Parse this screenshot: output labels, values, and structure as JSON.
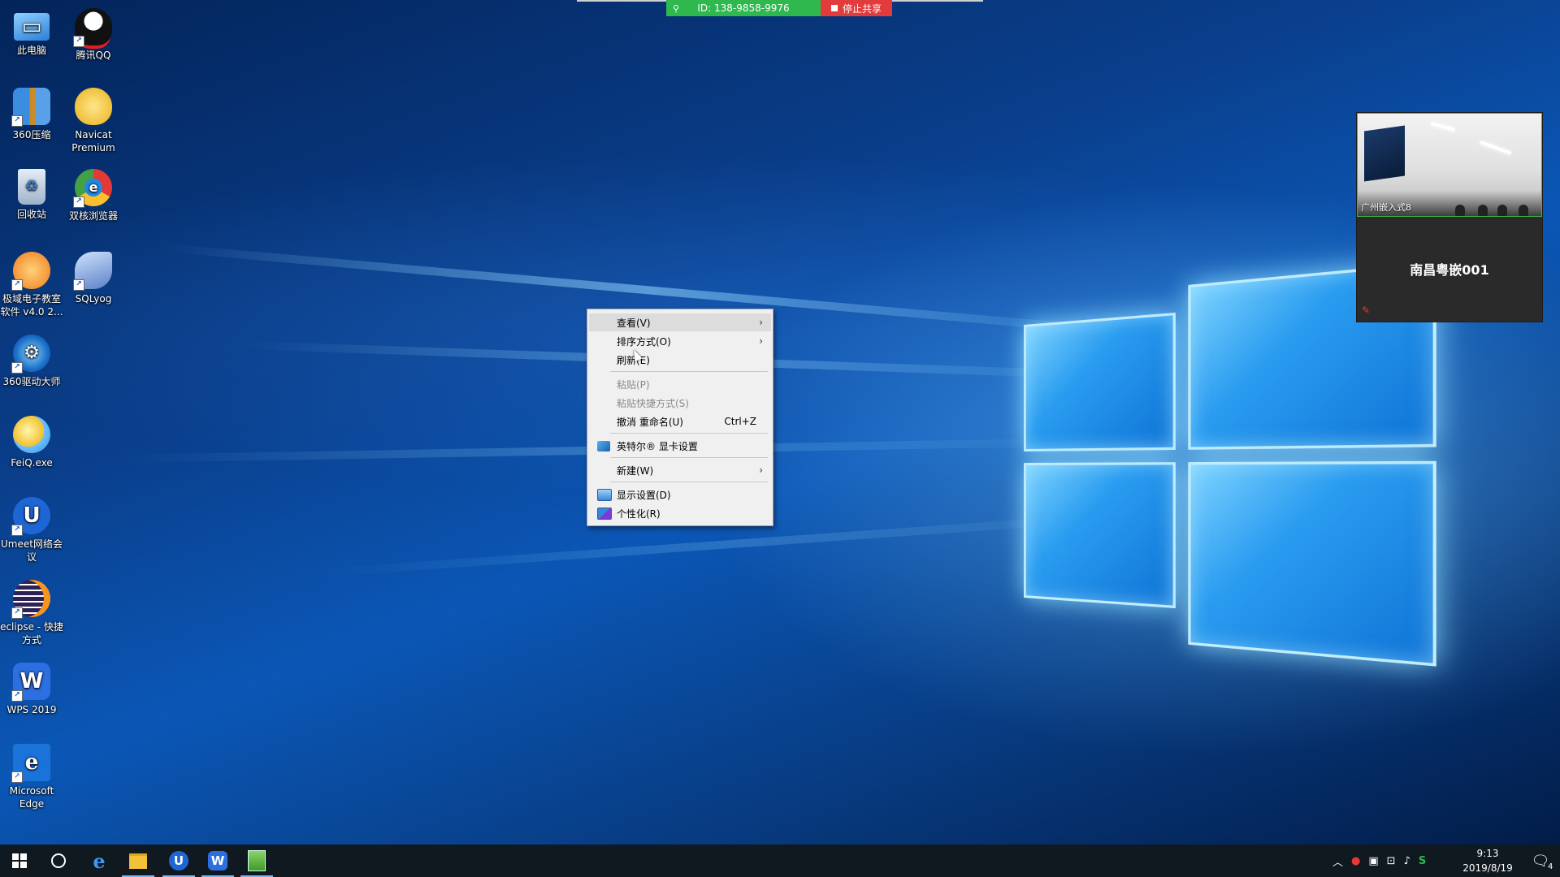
{
  "share_bar": {
    "meeting_id": "ID: 138-9858-9976",
    "stop_label": "停止共享"
  },
  "desktop_icons": [
    {
      "label": "此电脑",
      "icon": "computer-icon"
    },
    {
      "label": "腾讯QQ",
      "icon": "qq-penguin-icon"
    },
    {
      "label": "360压缩",
      "icon": "archive-icon"
    },
    {
      "label": "Navicat Premium",
      "icon": "navicat-icon"
    },
    {
      "label": "回收站",
      "icon": "recycle-bin-icon"
    },
    {
      "label": "双核浏览器",
      "icon": "browser-icon"
    },
    {
      "label": "极域电子教室软件 v4.0 2...",
      "icon": "classroom-icon"
    },
    {
      "label": "SQLyog",
      "icon": "sqlyog-dolphin-icon"
    },
    {
      "label": "360驱动大师",
      "icon": "driver-gear-icon"
    },
    {
      "label": "FeiQ.exe",
      "icon": "feiq-icon"
    },
    {
      "label": "Umeet网络会议",
      "icon": "umeet-icon"
    },
    {
      "label": "eclipse - 快捷方式",
      "icon": "eclipse-icon"
    },
    {
      "label": "WPS 2019",
      "icon": "wps-icon"
    },
    {
      "label": "Microsoft Edge",
      "icon": "edge-icon"
    }
  ],
  "context_menu": {
    "items": [
      {
        "label": "查看(V)",
        "submenu": true
      },
      {
        "label": "排序方式(O)",
        "submenu": true
      },
      {
        "label": "刷新(E)"
      },
      {
        "label": "粘贴(P)",
        "disabled": true
      },
      {
        "label": "粘贴快捷方式(S)",
        "disabled": true
      },
      {
        "label": "撤消 重命名(U)",
        "shortcut": "Ctrl+Z"
      },
      {
        "label": "英特尔® 显卡设置",
        "icon": "intel-graphics-icon"
      },
      {
        "label": "新建(W)",
        "submenu": true
      },
      {
        "label": "显示设置(D)",
        "icon": "display-icon"
      },
      {
        "label": "个性化(R)",
        "icon": "personalize-icon"
      }
    ],
    "arrow": "›"
  },
  "video_panel": {
    "camera_label": "广州嵌入式8",
    "participant_name": "南昌粤嵌001"
  },
  "taskbar": {
    "clock_time": "9:13",
    "clock_date": "2019/8/19",
    "notification_count": "4"
  },
  "colors": {
    "share_green": "#2fb84e",
    "share_red": "#e23b3b",
    "taskbar": "#101820",
    "menu_bg": "#f0f0f0"
  }
}
